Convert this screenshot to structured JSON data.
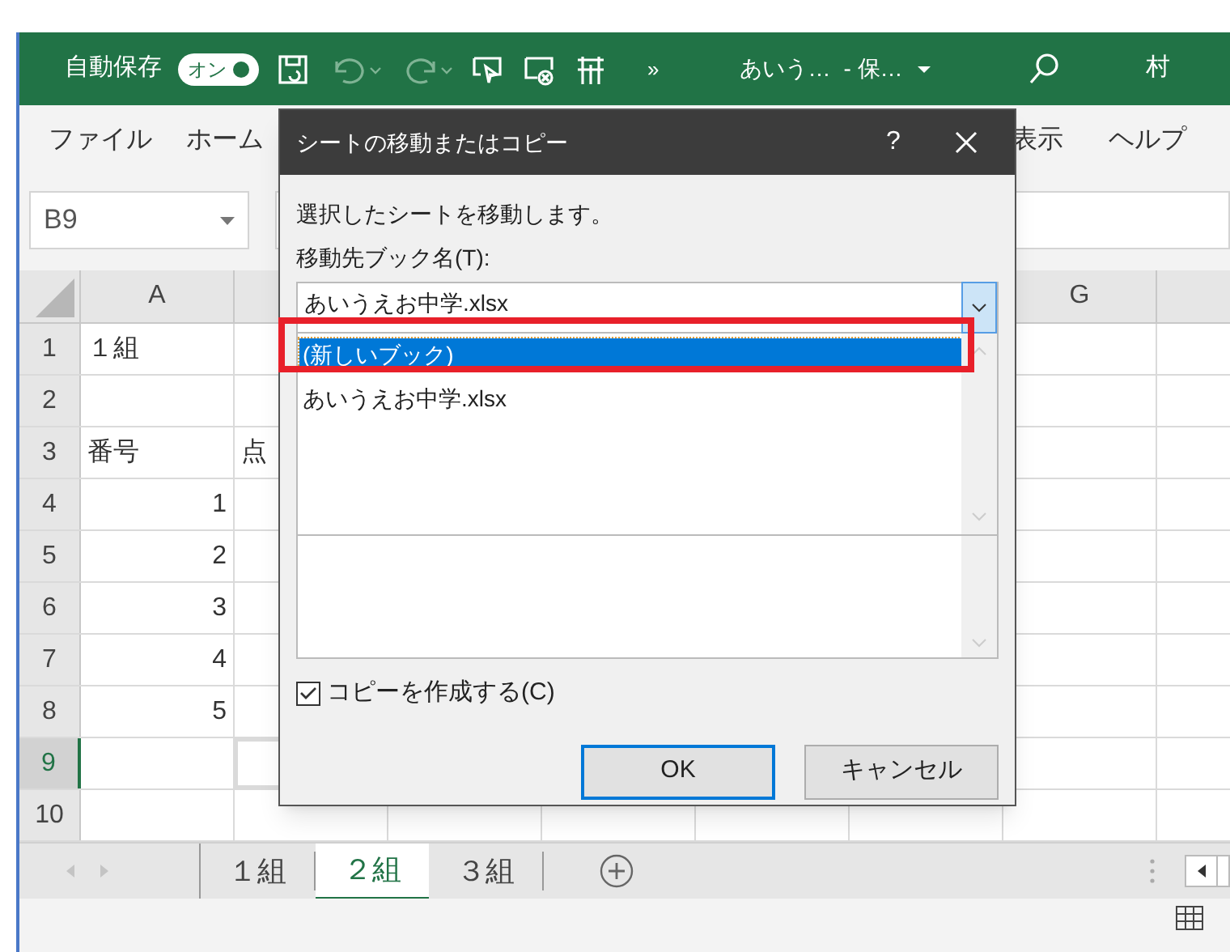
{
  "title_bar": {
    "autosave_label": "自動保存",
    "autosave_toggle": {
      "label": "オン",
      "on": true
    },
    "more": "»",
    "file_name": "あいう…",
    "save_status": "- 保…",
    "user": "村"
  },
  "ribbon_tabs": [
    {
      "label": "ファイル"
    },
    {
      "label": "ホーム"
    },
    {
      "label": "表示"
    },
    {
      "label": "ヘルプ"
    }
  ],
  "name_box": "B9",
  "columns": [
    {
      "label": "A"
    },
    {
      "label": "G"
    }
  ],
  "rows": [
    {
      "number": "1",
      "selected": false,
      "cells": [
        {
          "text": "１組",
          "kind": "text"
        }
      ]
    },
    {
      "number": "2",
      "selected": false,
      "cells": []
    },
    {
      "number": "3",
      "selected": false,
      "cells": [
        {
          "text": "番号",
          "kind": "text"
        },
        {
          "text": "点",
          "kind": "text"
        }
      ]
    },
    {
      "number": "4",
      "selected": false,
      "cells": [
        {
          "text": "1",
          "kind": "number"
        }
      ]
    },
    {
      "number": "5",
      "selected": false,
      "cells": [
        {
          "text": "2",
          "kind": "number"
        }
      ]
    },
    {
      "number": "6",
      "selected": false,
      "cells": [
        {
          "text": "3",
          "kind": "number"
        }
      ]
    },
    {
      "number": "7",
      "selected": false,
      "cells": [
        {
          "text": "4",
          "kind": "number"
        }
      ]
    },
    {
      "number": "8",
      "selected": false,
      "cells": [
        {
          "text": "5",
          "kind": "number"
        }
      ]
    },
    {
      "number": "9",
      "selected": true,
      "cells": []
    },
    {
      "number": "10",
      "selected": false,
      "cells": []
    }
  ],
  "sheet_tabs": [
    {
      "label": "１組",
      "selected": false
    },
    {
      "label": "２組",
      "selected": true
    },
    {
      "label": "３組",
      "selected": false
    }
  ],
  "dialog": {
    "title": "シートの移動またはコピー",
    "help": "?",
    "instruction": "選択したシートを移動します。",
    "book_label": "移動先ブック名(T):",
    "book_value": "あいうえお中学.xlsx",
    "book_options": [
      {
        "label": "(新しいブック)",
        "selected": true
      },
      {
        "label": "あいうえお中学.xlsx",
        "selected": false
      }
    ],
    "copy_checkbox": {
      "label": "コピーを作成する(C)",
      "checked": true
    },
    "buttons": [
      {
        "label": "OK",
        "default": true
      },
      {
        "label": "キャンセル",
        "default": false
      }
    ]
  }
}
